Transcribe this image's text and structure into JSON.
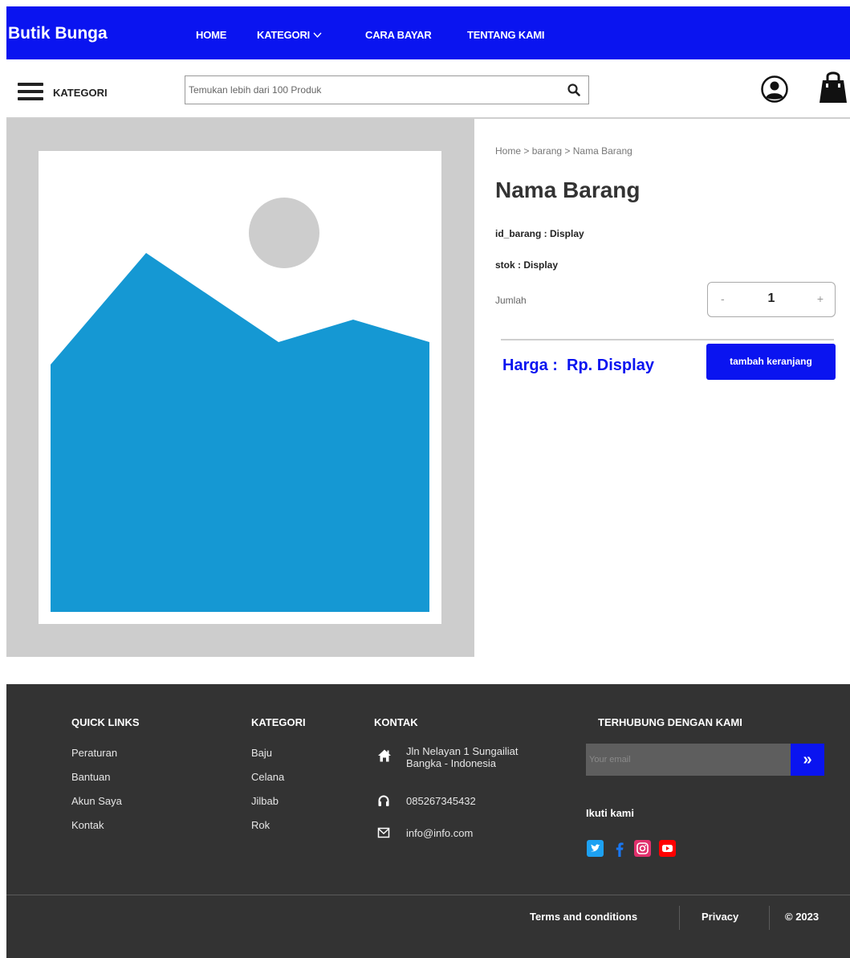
{
  "header": {
    "brand": "Butik Bunga",
    "nav": {
      "home": "HOME",
      "kategori": "KATEGORI",
      "cara_bayar": "CARA BAYAR",
      "tentang_kami": "TENTANG KAMI"
    }
  },
  "toolbar": {
    "kategori_label": "KATEGORI",
    "search_placeholder": "Temukan lebih dari 100 Produk"
  },
  "product": {
    "breadcrumb": [
      "Home >",
      "barang >",
      "Nama Barang"
    ],
    "name": "Nama Barang",
    "id_line": "id_barang : Display",
    "stok_line": "stok : Display",
    "jumlah_label": "Jumlah",
    "qty_minus": "-",
    "qty_value": "1",
    "qty_plus": "+",
    "price": "Harga :  Rp. Display",
    "add_to_cart": "tambah keranjang"
  },
  "footer": {
    "quick_links": {
      "title": "QUICK LINKS",
      "items": [
        "Peraturan",
        "Bantuan",
        "Akun Saya",
        "Kontak"
      ]
    },
    "kategori": {
      "title": "KATEGORI",
      "items": [
        "Baju",
        "Celana",
        "Jilbab",
        "Rok"
      ]
    },
    "kontak": {
      "title": "KONTAK",
      "address_line1": "Jln Nelayan 1 Sungailiat",
      "address_line2": "Bangka - Indonesia",
      "phone": "085267345432",
      "email": "info@info.com"
    },
    "terhubung": {
      "title": "TERHUBUNG DENGAN KAMI",
      "email_placeholder": "Your email",
      "submit_glyph": "»",
      "follow_label": "Ikuti kami"
    },
    "bottom": {
      "terms": "Terms and conditions",
      "privacy": "Privacy",
      "copyright": "© 2023"
    }
  },
  "colors": {
    "primary": "#0a14f0",
    "footer_bg": "#333333",
    "image_frame": "#cdcdcd",
    "mountain": "#1598d3",
    "twitter": "#1da1f2",
    "facebook": "#1877f2",
    "instagram": "#e1306c",
    "youtube": "#ff0000"
  }
}
